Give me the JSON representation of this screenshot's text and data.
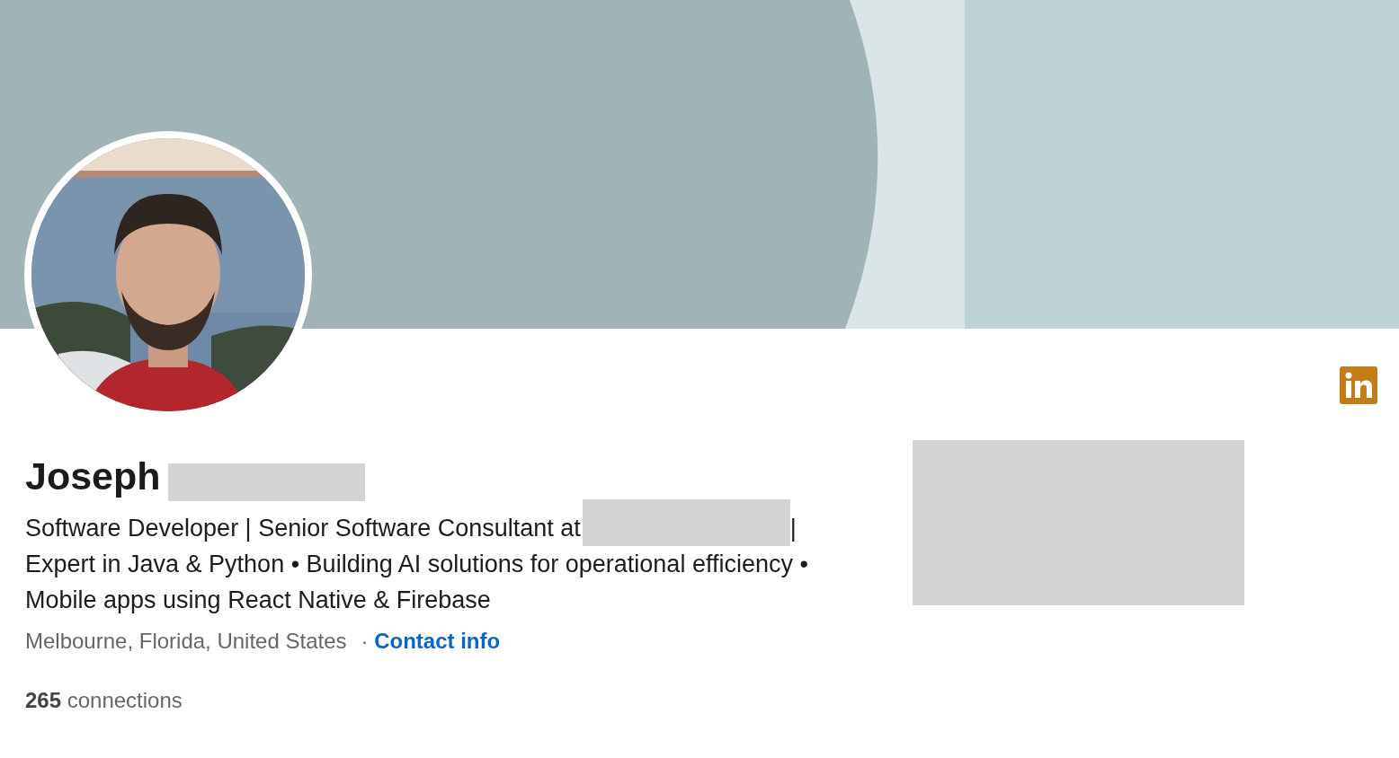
{
  "profile": {
    "name": "Joseph",
    "headline_parts": [
      "Software Developer | Senior Software Consultant at",
      "|",
      "Expert in Java & Python • Building AI solutions for operational efficiency • Mobile apps using React Native & Firebase"
    ],
    "location": "Melbourne, Florida, United States",
    "separator": "·",
    "contact_link": "Contact info",
    "connections": "**265** connections"
  }
}
